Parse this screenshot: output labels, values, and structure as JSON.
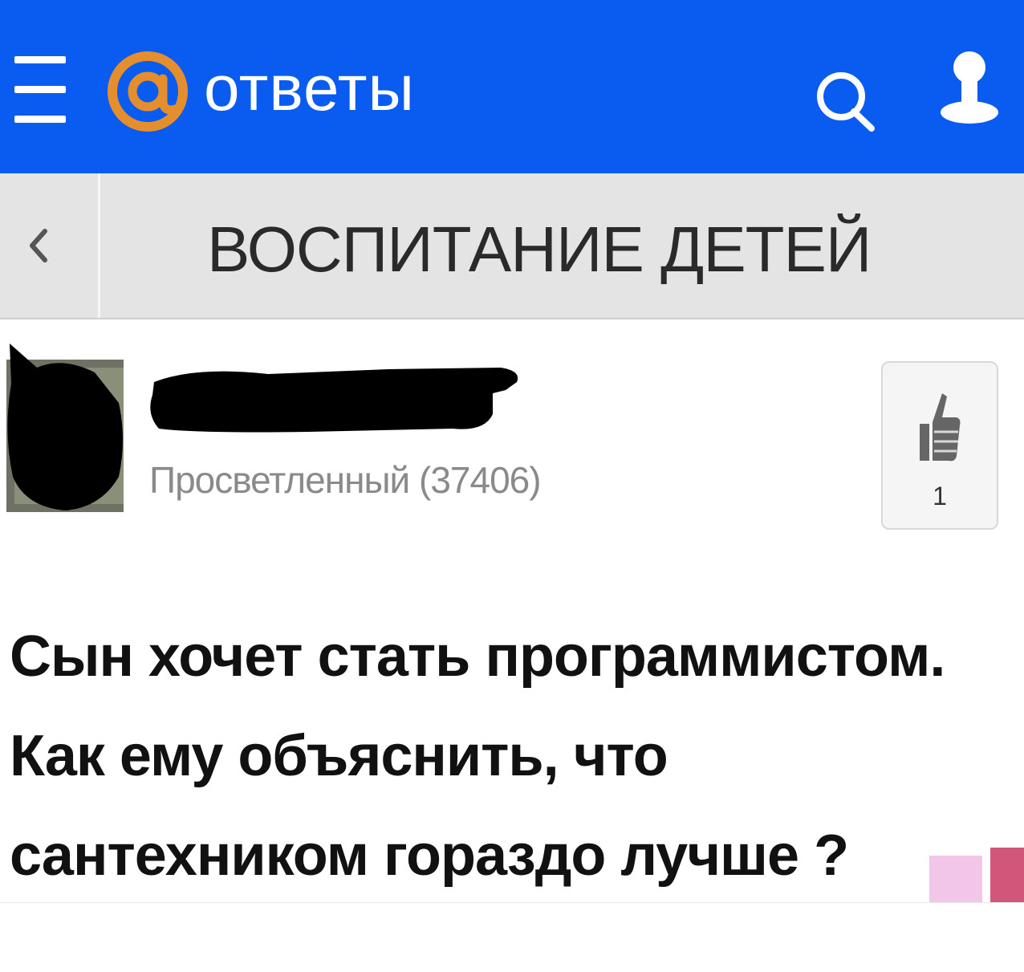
{
  "header": {
    "logo_text": "ответы",
    "background_color": "#0a5cf0",
    "logo_at_color": "#e58e2e",
    "icons": [
      "menu-icon",
      "at-logo-icon",
      "search-icon",
      "user-icon"
    ]
  },
  "category": {
    "back_icon": "chevron-left-icon",
    "title": "ВОСПИТАНИЕ ДЕТЕЙ"
  },
  "post": {
    "author_rank": "Просветленный (37406)",
    "like_icon": "thumbs-up-icon",
    "likes": "1",
    "question_lines": [
      "Сын хочет стать программистом.",
      "Как ему объяснить, что",
      "сантехником гораздо лучше ?"
    ]
  }
}
